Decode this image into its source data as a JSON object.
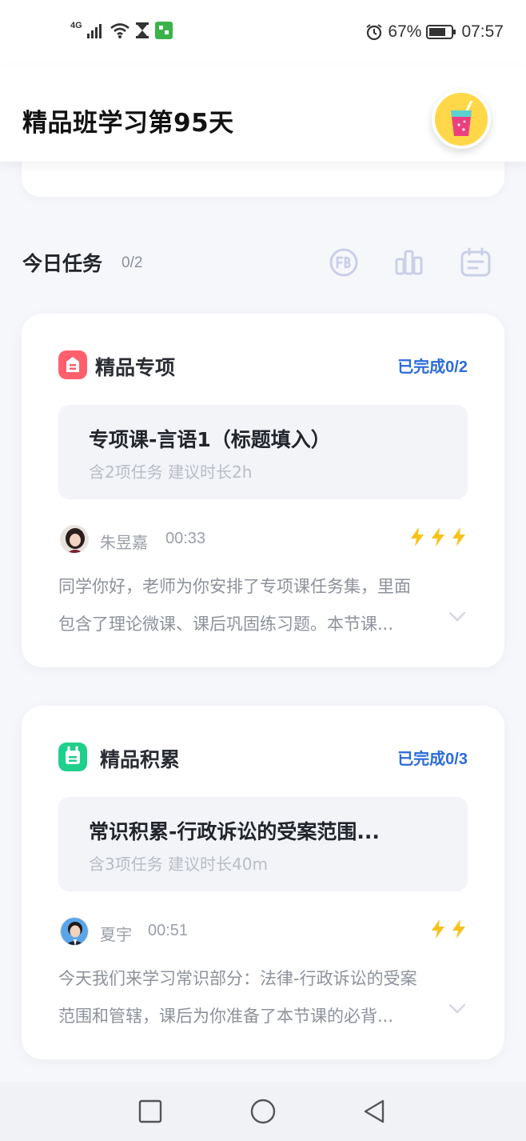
{
  "status_bar": {
    "network": "4G",
    "battery_percent": "67%",
    "time": "07:57",
    "left_icons": [
      "signal-icon",
      "wifi-icon",
      "hourglass-icon",
      "app-notification-icon"
    ],
    "right_icons": [
      "alarm-icon",
      "battery-icon"
    ]
  },
  "header": {
    "title": "精品班学习第95天",
    "badge_icon": "juice-cup-icon"
  },
  "tasks": {
    "title": "今日任务",
    "count": "0/2",
    "tools": [
      "fb-coin-icon",
      "bar-chart-icon",
      "calendar-icon"
    ]
  },
  "cards": [
    {
      "icon_color": "#ff5f6d",
      "title": "精品专项",
      "progress": "已完成0/2",
      "lesson_title": "专项课-言语1（标题填入）",
      "lesson_sub": "含2项任务 建议时长2h",
      "teacher_name": "朱昱嘉",
      "teacher_time": "00:33",
      "difficulty": 3,
      "desc_line1": "同学你好，老师为你安排了专项课任务集，里面",
      "desc_line2": "包含了理论微课、课后巩固练习题。本节课..."
    },
    {
      "icon_color": "#1fcf8c",
      "title": "精品积累",
      "progress": "已完成0/3",
      "lesson_title": "常识积累-行政诉讼的受案范围...",
      "lesson_sub": "含3项任务 建议时长40m",
      "teacher_name": "夏宇",
      "teacher_time": "00:51",
      "difficulty": 2,
      "desc_line1": "今天我们来学习常识部分：法律-行政诉讼的受案",
      "desc_line2": "范围和管辖，课后为你准备了本节课的必背..."
    }
  ],
  "accent_colors": {
    "progress_blue": "#2d6bd9",
    "bolt_yellow": "#f7c21a"
  },
  "nav_bar": [
    "square-nav-icon",
    "circle-home-icon",
    "triangle-back-icon"
  ]
}
